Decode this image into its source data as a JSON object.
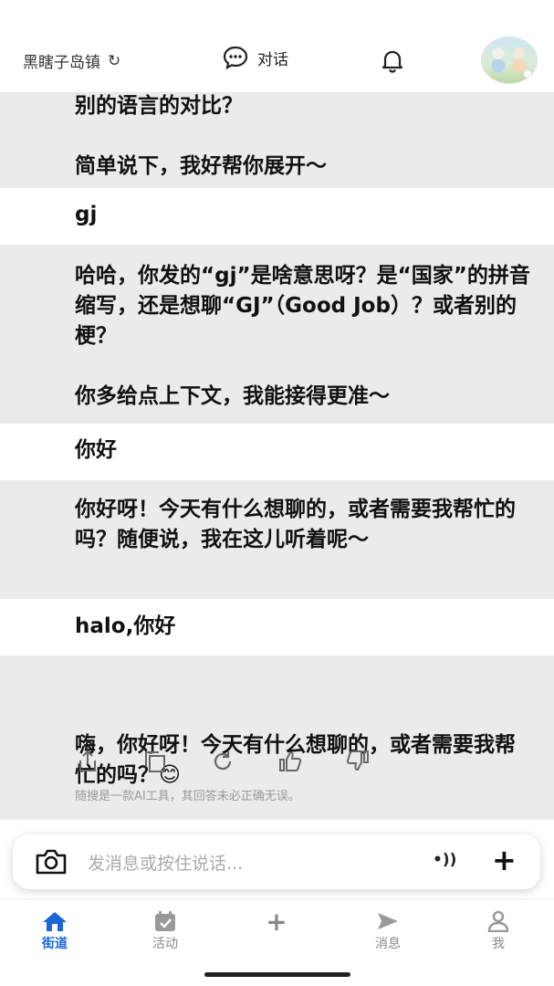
{
  "header": {
    "location": "黑瞎子岛镇",
    "chat_tab": "对话",
    "icons": [
      "refresh-icon",
      "chat-bubble-icon",
      "bell-icon",
      "avatar"
    ]
  },
  "messages": [
    {
      "role": "ai",
      "text": "别的语言的对比？\n\n简单说下，我好帮你展开～"
    },
    {
      "role": "user",
      "text": "gj"
    },
    {
      "role": "ai",
      "text": "哈哈，你发的“gj”是啥意思呀？是“国家”的拼音缩写，还是想聊“GJ”（Good Job）？或者别的梗？\n\n你多给点上下文，我能接得更准～"
    },
    {
      "role": "user",
      "text": "你好"
    },
    {
      "role": "ai",
      "text": "你好呀！今天有什么想聊的，或者需要我帮忙的吗？随便说，我在这儿听着呢～"
    },
    {
      "role": "user",
      "text": "halo,你好"
    },
    {
      "role": "ai",
      "text": "嗨，你好呀！今天有什么想聊的，或者需要我帮忙的吗？😊"
    }
  ],
  "message_actions": [
    "share-icon",
    "copy-icon",
    "regenerate-icon",
    "like-icon",
    "dislike-icon"
  ],
  "disclaimer": "随搜是一款AI工具，其回答未必正确无误。",
  "input": {
    "placeholder": "发消息或按住说话...",
    "voice_label": "•))",
    "plus_label": "+"
  },
  "nav": {
    "items": [
      {
        "label": "街道",
        "icon": "home-icon",
        "active": true
      },
      {
        "label": "活动",
        "icon": "activity-icon",
        "active": false
      },
      {
        "label": "",
        "icon": "plus-icon",
        "active": false
      },
      {
        "label": "消息",
        "icon": "send-icon",
        "active": false
      },
      {
        "label": "我",
        "icon": "profile-icon",
        "active": false
      }
    ]
  },
  "colors": {
    "accent": "#1a66d9",
    "ai_bubble": "#ebebeb"
  }
}
